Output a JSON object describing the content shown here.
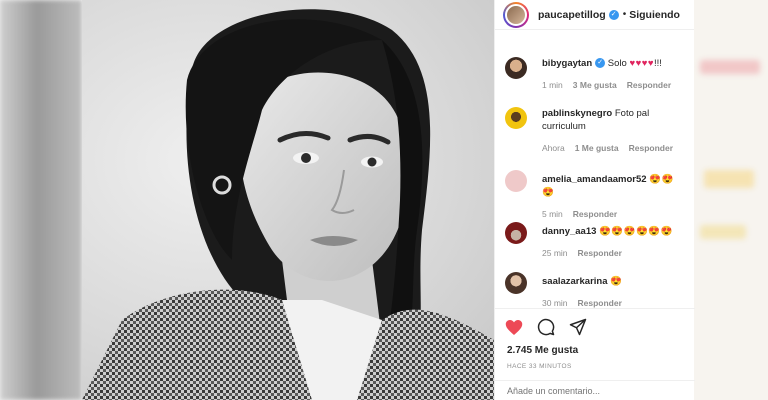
{
  "post": {
    "author": "paucapetillog",
    "follow_dot": "•",
    "follow_label": "Siguiendo"
  },
  "comments": [
    {
      "user": "bibygaytan",
      "verified": true,
      "text": "Solo",
      "emoji": "♥♥♥♥",
      "suffix": "!!!",
      "time": "1 min",
      "likes": "3 Me gusta",
      "reply": "Responder"
    },
    {
      "user": "pablinskynegro",
      "verified": false,
      "text": "Foto pal curriculum",
      "emoji": "",
      "suffix": "",
      "time": "Ahora",
      "likes": "1 Me gusta",
      "reply": "Responder"
    },
    {
      "user": "amelia_amandaamor52",
      "verified": false,
      "text": "",
      "emoji": "😍😍😍",
      "suffix": "",
      "time": "5 min",
      "likes": "",
      "reply": "Responder"
    },
    {
      "user": "danny_aa13",
      "verified": false,
      "text": "",
      "emoji": "😍😍😍😍😍😍",
      "suffix": "",
      "time": "25 min",
      "likes": "",
      "reply": "Responder"
    },
    {
      "user": "saalazarkarina",
      "verified": false,
      "text": "",
      "emoji": "😍",
      "suffix": "",
      "time": "30 min",
      "likes": "",
      "reply": "Responder"
    }
  ],
  "stats": {
    "likes": "2.745 Me gusta",
    "ago": "HACE 33 MINUTOS"
  },
  "comment_box": {
    "placeholder": "Añade un comentario..."
  },
  "icons": [
    "heart-icon",
    "comment-icon",
    "share-icon"
  ],
  "colors": {
    "like_red": "#ed4956",
    "verified_blue": "#3897f0"
  }
}
